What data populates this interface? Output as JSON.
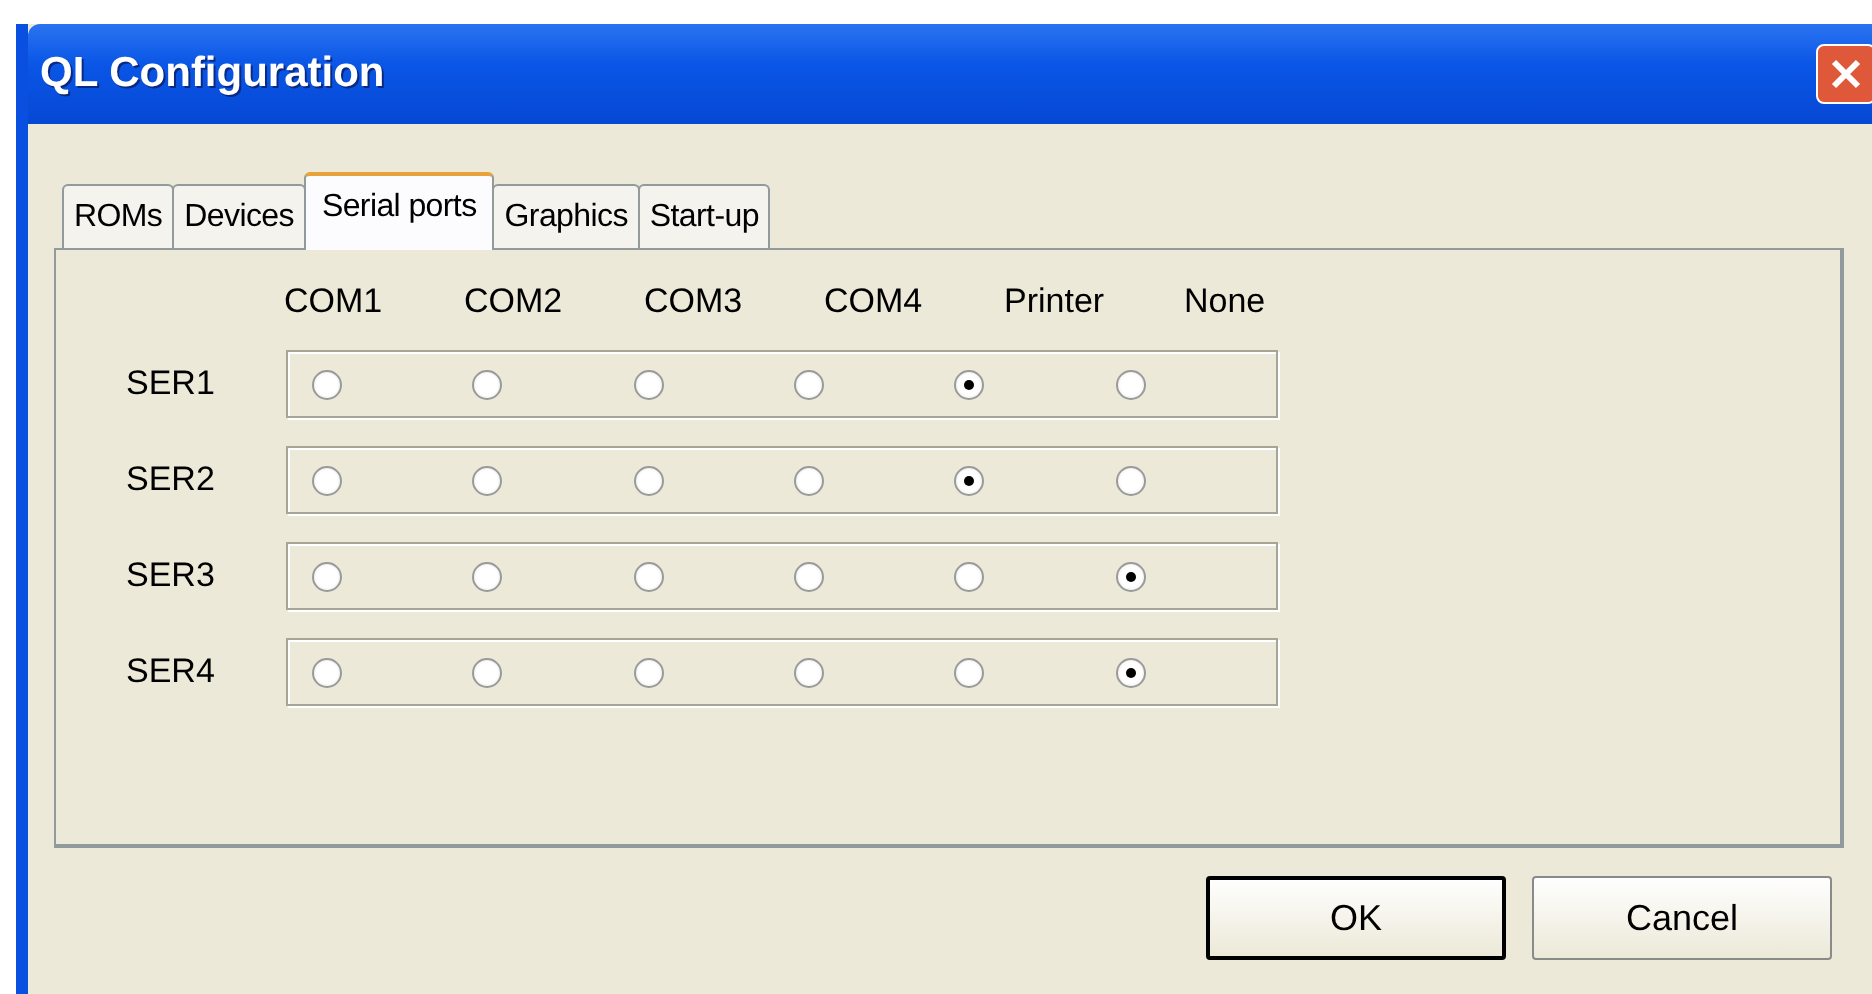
{
  "window": {
    "title": "QL Configuration"
  },
  "tabs": [
    {
      "label": "ROMs",
      "selected": false
    },
    {
      "label": "Devices",
      "selected": false
    },
    {
      "label": "Serial ports",
      "selected": true
    },
    {
      "label": "Graphics",
      "selected": false
    },
    {
      "label": "Start-up",
      "selected": false
    }
  ],
  "columns": [
    "COM1",
    "COM2",
    "COM3",
    "COM4",
    "Printer",
    "None"
  ],
  "rows": [
    {
      "label": "SER1",
      "options": [
        {
          "selected": false
        },
        {
          "selected": false
        },
        {
          "selected": false
        },
        {
          "selected": false
        },
        {
          "selected": true
        },
        {
          "selected": false
        }
      ]
    },
    {
      "label": "SER2",
      "options": [
        {
          "selected": false
        },
        {
          "selected": false
        },
        {
          "selected": false
        },
        {
          "selected": false
        },
        {
          "selected": true
        },
        {
          "selected": false
        }
      ]
    },
    {
      "label": "SER3",
      "options": [
        {
          "selected": false
        },
        {
          "selected": false
        },
        {
          "selected": false
        },
        {
          "selected": false
        },
        {
          "selected": false
        },
        {
          "selected": true
        }
      ]
    },
    {
      "label": "SER4",
      "options": [
        {
          "selected": false
        },
        {
          "selected": false
        },
        {
          "selected": false
        },
        {
          "selected": false
        },
        {
          "selected": false
        },
        {
          "selected": true
        }
      ]
    }
  ],
  "buttons": [
    {
      "label": "OK",
      "default": true
    },
    {
      "label": "Cancel",
      "default": false
    }
  ]
}
